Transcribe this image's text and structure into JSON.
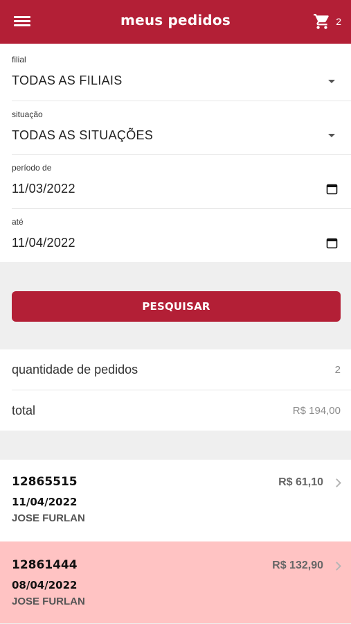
{
  "header": {
    "title": "meus pedidos",
    "cart_count": "2"
  },
  "filters": {
    "branch_label": "filial",
    "branch_value": "TODAS AS FILIAIS",
    "status_label": "situação",
    "status_value": "TODAS AS SITUAÇÕES",
    "from_label": "período de",
    "from_value": "11/03/2022",
    "to_label": "até",
    "to_value": "11/04/2022"
  },
  "search_button": "PESQUISAR",
  "summary": {
    "count_label": "quantidade de pedidos",
    "count_value": "2",
    "total_label": "total",
    "total_value": "R$ 194,00"
  },
  "orders": [
    {
      "number": "12865515",
      "date": "11/04/2022",
      "customer": "JOSE FURLAN",
      "value": "R$ 61,10",
      "bg": "#ffffff"
    },
    {
      "number": "12861444",
      "date": "08/04/2022",
      "customer": "JOSE FURLAN",
      "value": "R$ 132,90",
      "bg": "#ffc3c3"
    }
  ],
  "colors": {
    "brand": "#b31f36",
    "highlight": "#ffc3c3"
  }
}
